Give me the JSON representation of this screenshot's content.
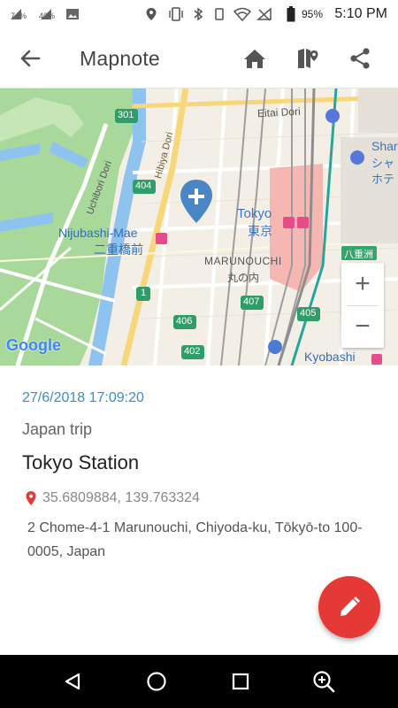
{
  "status_bar": {
    "signal1_pct": "74%",
    "signal2_pct": "40%",
    "battery_pct": "95%",
    "time": "5:10 PM"
  },
  "toolbar": {
    "title": "Mapnote",
    "back_icon": "arrow-back-icon",
    "home_icon": "home-icon",
    "map_icon": "map-marker-icon",
    "share_icon": "share-icon"
  },
  "map": {
    "labels": {
      "eitai": "Eitai Dori",
      "shar": "Shar",
      "shar_jp": "シャ",
      "hote_jp": "ホテ",
      "tokyo": "Tokyo",
      "tokyo_jp": "東京",
      "hibiya": "Hibiya Dori",
      "uchibori": "Uchibori Dori",
      "nijubashi": "Nijubashi-Mae",
      "nijubashi_jp": "二重橋前",
      "marunouchi": "MARUNOUCHI",
      "marunouchi_jp": "丸の内",
      "yaesu_jp": "八重洲",
      "kyobashi": "Kyobashi",
      "google": "Google",
      "r301": "301",
      "r404": "404",
      "r407": "407",
      "r406": "406",
      "r402": "402",
      "r405": "405",
      "r1": "1"
    },
    "zoom_in": "+",
    "zoom_out": "−"
  },
  "note": {
    "date": "27/6/2018 17:09:20",
    "category": "Japan trip",
    "name": "Tokyo Station",
    "coords": "35.6809884, 139.763324",
    "address": "2 Chome-4-1 Marunouchi, Chiyoda-ku, Tōkyō-to 100-0005, Japan"
  },
  "colors": {
    "accent_blue": "#3a8fc4",
    "fab_red": "#e53935",
    "marker_blue": "#4a86c5"
  }
}
